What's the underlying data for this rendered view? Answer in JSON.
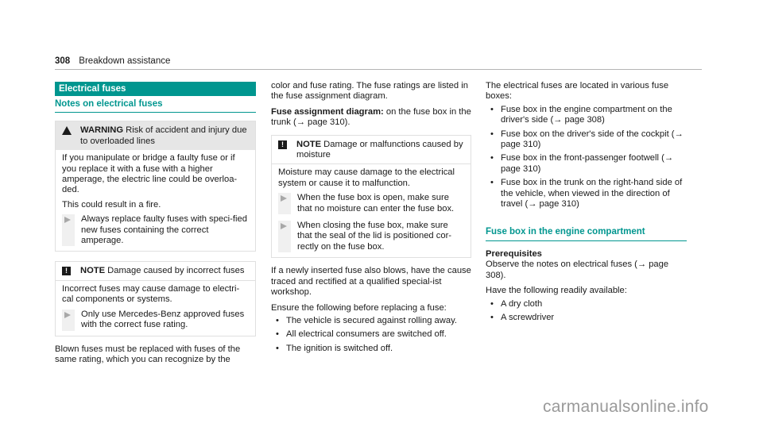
{
  "header": {
    "page_number": "308",
    "section": "Breakdown assistance"
  },
  "col1": {
    "section_title": "Electrical fuses",
    "subheading": "Notes on electrical fuses",
    "warning": {
      "label": "WARNING",
      "title": " Risk of accident and injury due to overloaded lines",
      "body": [
        "If you manipulate or bridge a faulty fuse or if you replace it with a fuse with a higher amperage, the electric line could be overloa-ded.",
        "This could result in a fire."
      ],
      "step": "Always replace faulty fuses with speci-fied new fuses containing the correct amperage."
    },
    "note": {
      "label": "NOTE",
      "title": " Damage caused by incorrect fuses",
      "body": "Incorrect fuses may cause damage to electri-cal components or systems.",
      "step": "Only use Mercedes-Benz approved fuses with the correct fuse rating."
    },
    "closing_text": "Blown fuses must be replaced with fuses of the same rating, which you can recognize by the"
  },
  "col2": {
    "intro": "color and fuse rating. The fuse ratings are listed in the fuse assignment diagram.",
    "diagram_label": "Fuse assignment diagram:",
    "diagram_text": " on the fuse box in the trunk (→ page 310).",
    "note": {
      "label": "NOTE",
      "title": " Damage or malfunctions caused by moisture",
      "body": "Moisture may cause damage to the electrical system or cause it to malfunction.",
      "steps": [
        "When the fuse box is open, make sure that no moisture can enter the fuse box.",
        "When closing the fuse box, make sure that the seal of the lid is positioned cor-rectly on the fuse box."
      ]
    },
    "after_note": "If a newly inserted fuse also blows, have the cause traced and rectified at a qualified special-ist workshop.",
    "ensure_intro": "Ensure the following before replacing a fuse:",
    "ensure_items": [
      "The vehicle is secured against rolling away.",
      "All electrical consumers are switched off.",
      "The ignition is switched off."
    ]
  },
  "col3": {
    "intro": "The electrical fuses are located in various fuse boxes:",
    "locations": [
      "Fuse box in the engine compartment on the driver's side (→ page 308)",
      "Fuse box on the driver's side of the cockpit (→ page 310)",
      "Fuse box in the front-passenger footwell (→ page 310)",
      "Fuse box in the trunk on the right-hand side of the vehicle, when viewed in the direction of travel (→ page 310)"
    ],
    "subheading": "Fuse box in the engine compartment",
    "prereq_title": "Prerequisites",
    "prereq_text": "Observe the notes on electrical fuses (→ page 308).",
    "have_text": "Have the following readily available:",
    "have_items": [
      "A dry cloth",
      "A screwdriver"
    ]
  },
  "watermark": "carmanualsonline.info"
}
